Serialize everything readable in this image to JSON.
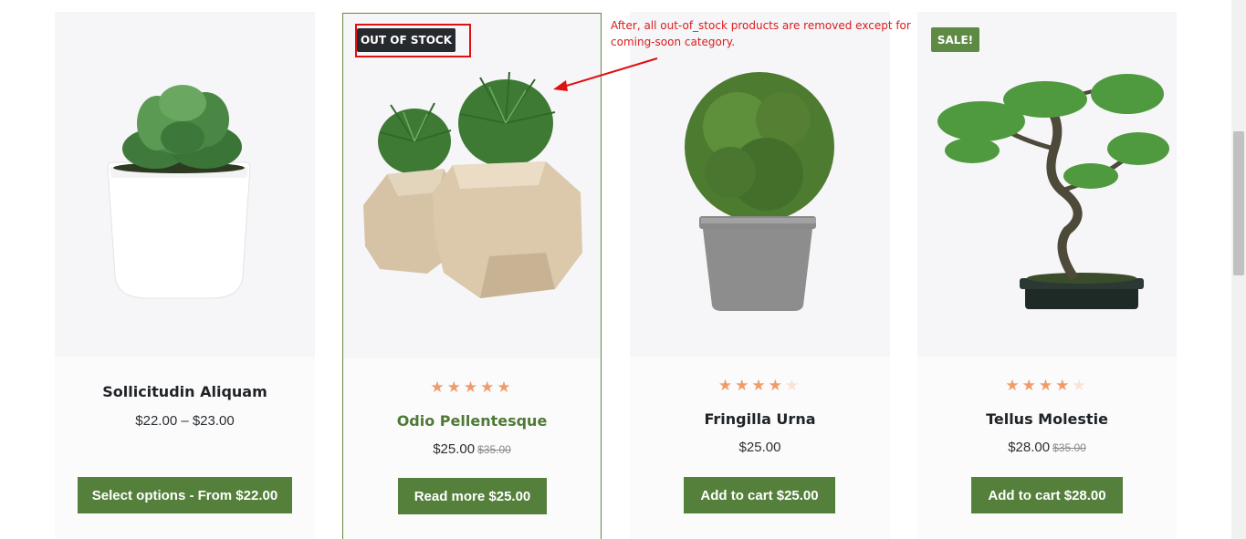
{
  "products": [
    {
      "name": "Sollicitudin Aliquam",
      "price": "$22.00 – $23.00",
      "old_price": "",
      "button": "Select options - From $22.00",
      "rating": 0
    },
    {
      "name": "Odio Pellentesque",
      "price": "$25.00",
      "old_price": "$35.00",
      "button": "Read more $25.00",
      "rating": 5,
      "badge": "OUT OF STOCK"
    },
    {
      "name": "Fringilla Urna",
      "price": "$25.00",
      "old_price": "",
      "button": "Add to cart $25.00",
      "rating": 4
    },
    {
      "name": "Tellus Molestie",
      "price": "$28.00",
      "old_price": "$35.00",
      "button": "Add to cart $28.00",
      "rating": 4,
      "badge": "SALE!"
    }
  ],
  "annotation": {
    "text": "After, all out-of_stock products are removed except for coming-soon category."
  },
  "colors": {
    "accent": "#55803b",
    "annotation": "#e01010",
    "star": "#f09c68"
  }
}
